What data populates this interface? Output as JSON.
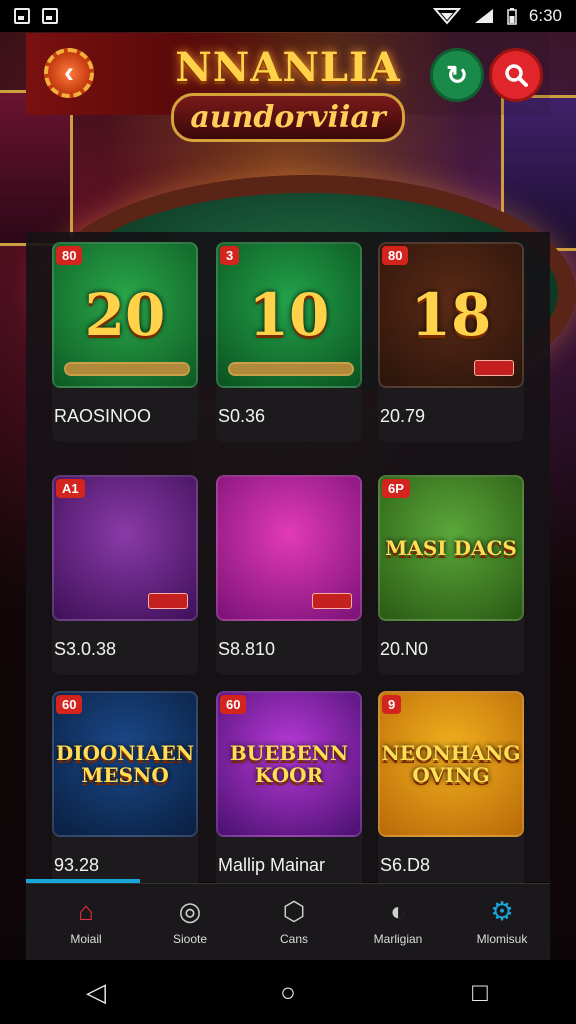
{
  "status_bar": {
    "time": "6:30"
  },
  "header": {
    "back_icon": "chevron-left-icon",
    "logo_title": "NNANLIA",
    "logo_subtitle": "aundorviiar",
    "refresh_icon": "refresh-icon",
    "search_icon": "search-icon"
  },
  "games": [
    {
      "tag": "80",
      "art_text": "20",
      "label": "RAOSINOO",
      "art_colors": [
        "#2aa84a",
        "#0d5a24"
      ]
    },
    {
      "tag": "3",
      "art_text": "10",
      "label": "S0.36",
      "art_colors": [
        "#23a24a",
        "#0a5220"
      ]
    },
    {
      "tag": "80",
      "art_text": "18",
      "label": "20.79",
      "art_colors": [
        "#5a2a16",
        "#2a140a"
      ]
    },
    {
      "tag": "A1",
      "art_text": "",
      "label": "S3.0.38",
      "art_colors": [
        "#8a3aa8",
        "#3e1058"
      ]
    },
    {
      "tag": "",
      "art_text": "",
      "label": "S8.810",
      "art_colors": [
        "#e23ab8",
        "#7a1276"
      ]
    },
    {
      "tag": "6P",
      "art_text": "MASI DACS",
      "label": "20.N0",
      "art_colors": [
        "#5aa83a",
        "#2a5a14"
      ]
    },
    {
      "tag": "60",
      "art_text": "DIOONIAEN MESNO",
      "label": "93.28",
      "art_colors": [
        "#1a4a8a",
        "#0a1e40"
      ]
    },
    {
      "tag": "60",
      "art_text": "BUEBENN KOOR",
      "label": "Mallip Mainar",
      "art_colors": [
        "#b83ad8",
        "#4a1070"
      ]
    },
    {
      "tag": "9",
      "art_text": "NEONHANG OVING",
      "label": "S6.D8",
      "art_colors": [
        "#f2b01e",
        "#b86a08"
      ]
    }
  ],
  "bottom_nav": [
    {
      "label": "Moiail",
      "icon": "home-icon"
    },
    {
      "label": "Sioote",
      "icon": "coins-icon"
    },
    {
      "label": "Cans",
      "icon": "dice-icon"
    },
    {
      "label": "Marligian",
      "icon": "globe-icon"
    },
    {
      "label": "Mlomisuk",
      "icon": "gear-icon"
    }
  ],
  "system_nav": {
    "back": "◁",
    "home": "○",
    "recents": "□"
  },
  "colors": {
    "accent": "#19a6d8",
    "header_red": "#7a1010",
    "search_red": "#e0262a",
    "refresh_green": "#1a8a4a"
  }
}
